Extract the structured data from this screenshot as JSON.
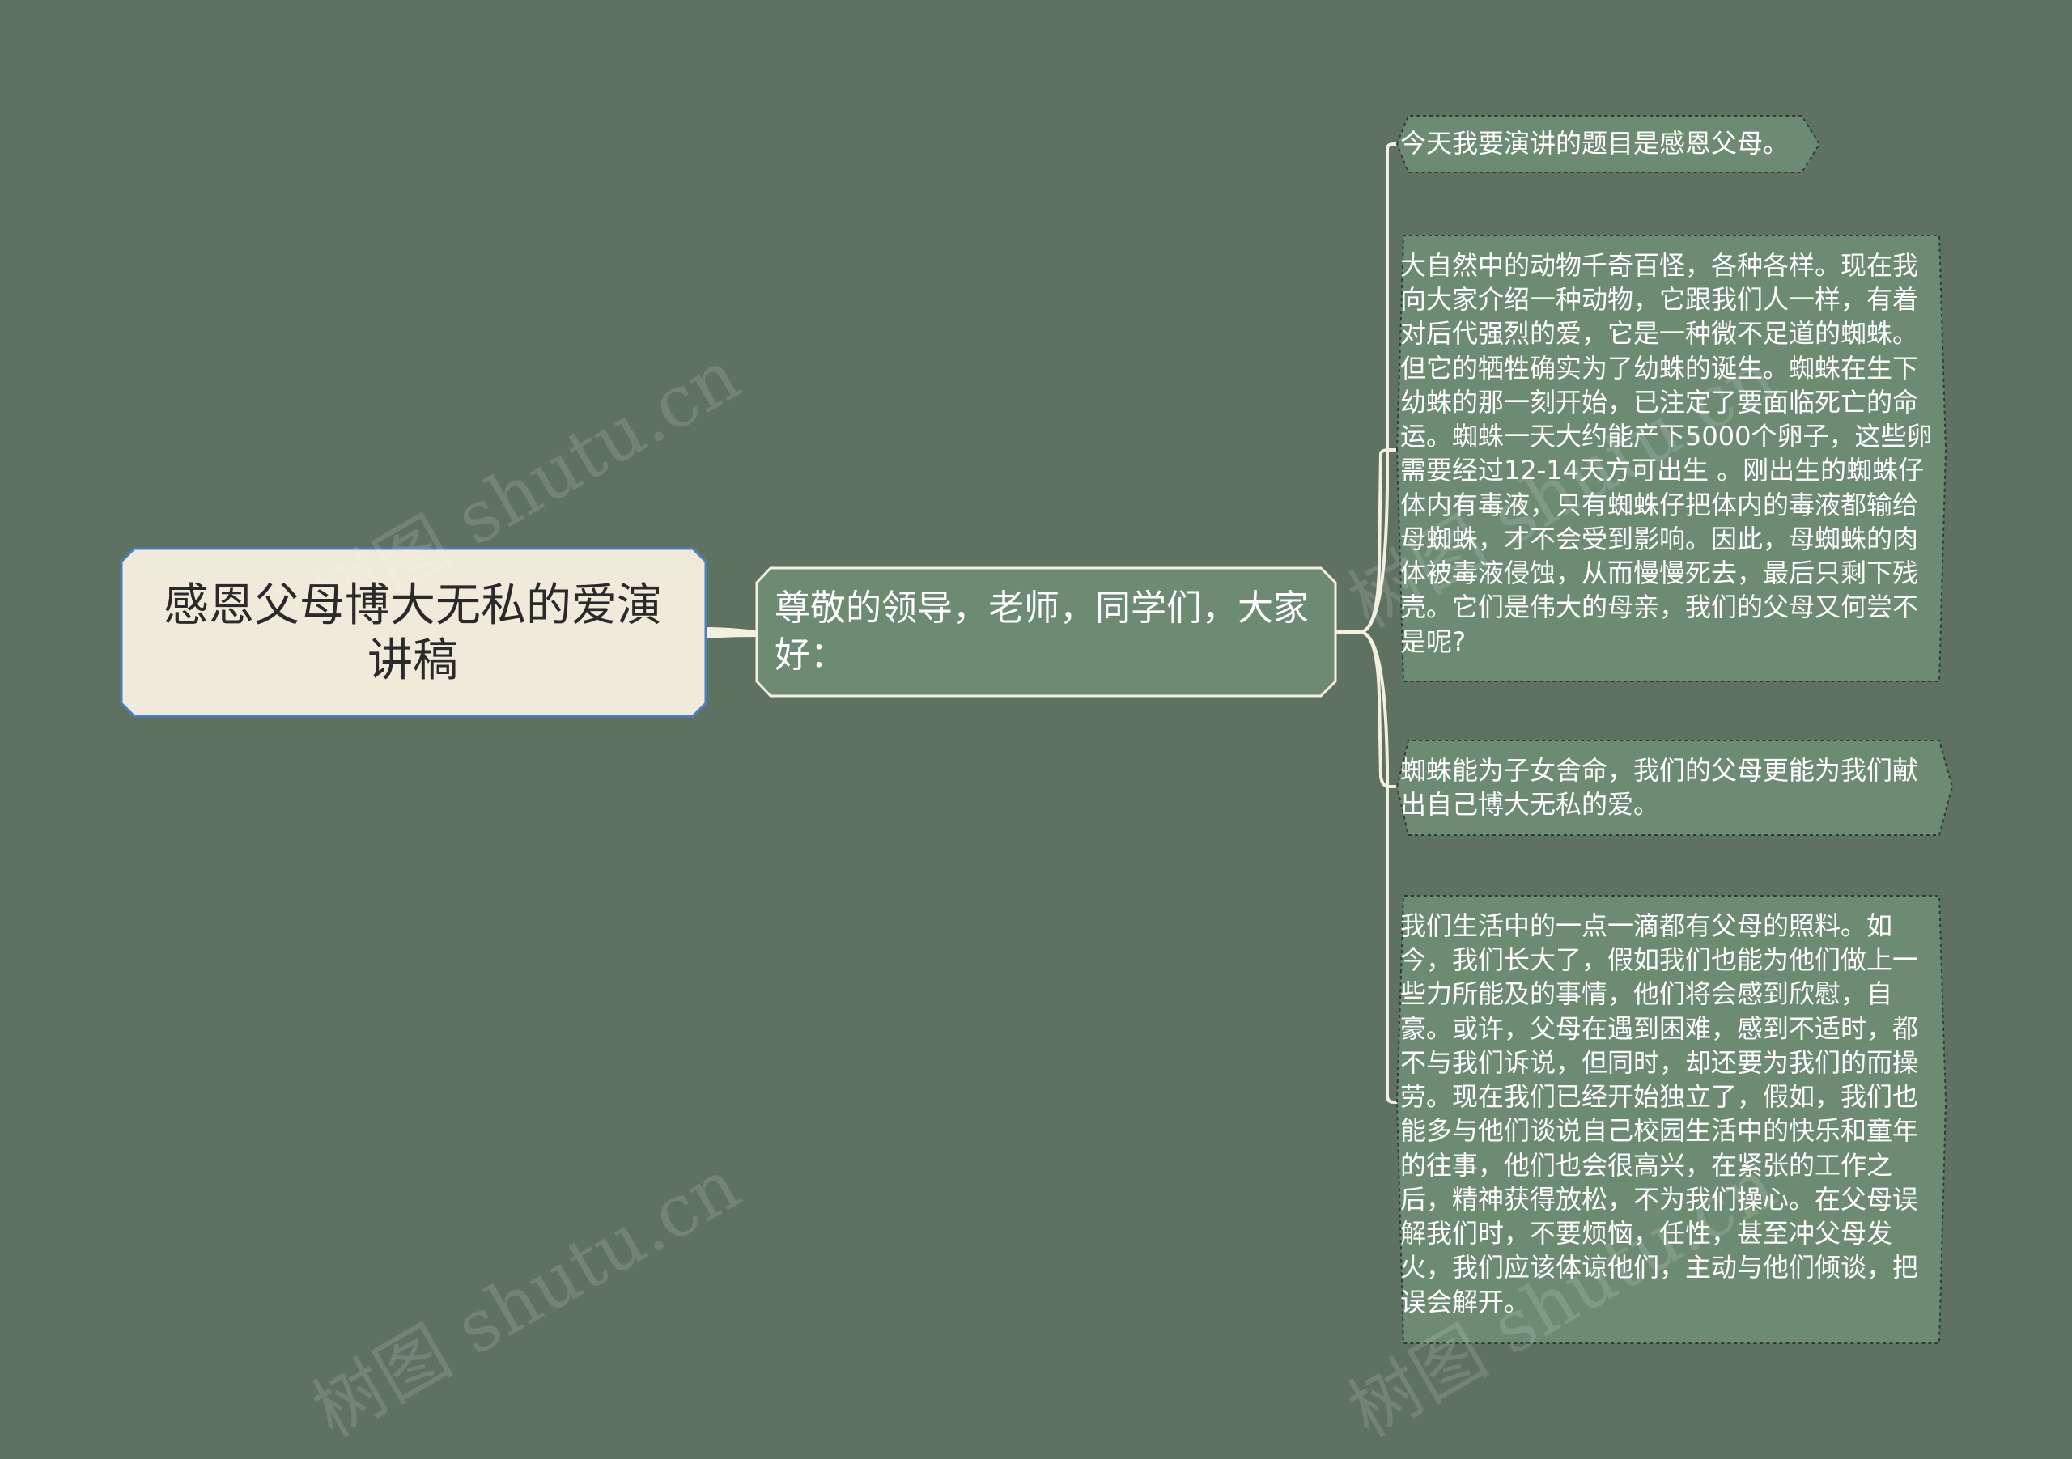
{
  "root": {
    "label": "感恩父母博大无私的爱演讲稿"
  },
  "mid": {
    "label": "尊敬的领导，老师，同学们，大家好："
  },
  "leaves": [
    {
      "label": "今天我要演讲的题目是感恩父母。"
    },
    {
      "label": "大自然中的动物千奇百怪，各种各样。现在我向大家介绍一种动物，它跟我们人一样，有着对后代强烈的爱，它是一种微不足道的蜘蛛。但它的牺牲确实为了幼蛛的诞生。蜘蛛在生下幼蛛的那一刻开始，已注定了要面临死亡的命运。蜘蛛一天大约能产下5000个卵子，这些卵需要经过12-14天方可出生 。刚出生的蜘蛛仔体内有毒液，只有蜘蛛仔把体内的毒液都输给母蜘蛛，才不会受到影响。因此，母蜘蛛的肉体被毒液侵蚀，从而慢慢死去，最后只剩下残壳。它们是伟大的母亲，我们的父母又何尝不是呢?"
    },
    {
      "label": "蜘蛛能为子女舍命，我们的父母更能为我们献出自己博大无私的爱。"
    },
    {
      "label": "我们生活中的一点一滴都有父母的照料。如今，我们长大了，假如我们也能为他们做上一些力所能及的事情，他们将会感到欣慰，自豪。或许，父母在遇到困难，感到不适时，都不与我们诉说，但同时，却还要为我们的而操劳。现在我们已经开始独立了，假如，我们也能多与他们谈说自己校园生活中的快乐和童年的往事，他们也会很高兴，在紧张的工作之后，精神获得放松，不为我们操心。在父母误解我们时，不要烦恼，任性，甚至冲父母发火，我们应该体谅他们，主动与他们倾谈，把误会解开。"
    }
  ],
  "watermark": {
    "text": "树图 shutu.cn"
  },
  "colors": {
    "background": "#5f7262",
    "root_fill": "#f0eadb",
    "root_border": "#4a7fc4",
    "node_fill": "#6d8b73",
    "node_border": "#f3f0e0",
    "connector": "#f3f0e0"
  }
}
